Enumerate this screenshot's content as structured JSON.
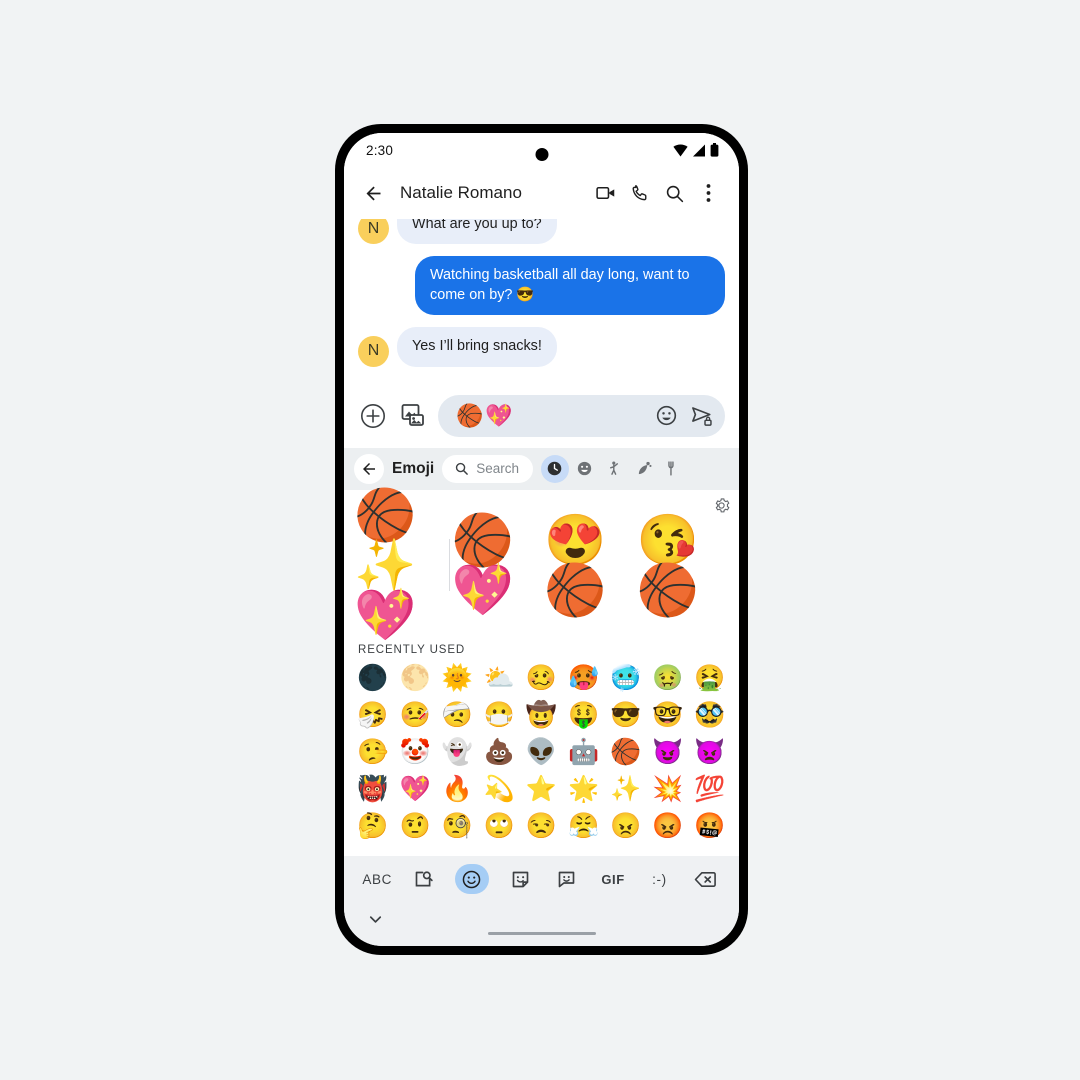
{
  "status_bar": {
    "time": "2:30",
    "icons": [
      "wifi-icon",
      "signal-icon",
      "battery-icon"
    ]
  },
  "app_bar": {
    "back_icon": "back-arrow-icon",
    "contact_name": "Natalie Romano",
    "actions": [
      "video-call-icon",
      "phone-call-icon",
      "search-icon",
      "overflow-menu-icon"
    ]
  },
  "conversation": {
    "messages": [
      {
        "sender": "Natalie Romano",
        "avatar_initial": "N",
        "direction": "incoming",
        "text": "What are you up to?",
        "clipped": true
      },
      {
        "sender": "me",
        "avatar_initial": "",
        "direction": "outgoing",
        "text": "Watching basketball all day long, want to come on by? 😎",
        "clipped": false
      },
      {
        "sender": "Natalie Romano",
        "avatar_initial": "N",
        "direction": "incoming",
        "text": "Yes I’ll bring snacks!",
        "clipped": false
      }
    ]
  },
  "compose_bar": {
    "add_icon": "plus-circle-icon",
    "gallery_icon": "gallery-icon",
    "draft_text": "🏀💖",
    "emoji_toggle_icon": "emoji-face-icon",
    "send_icon": "send-encrypted-icon"
  },
  "emoji_picker": {
    "back_icon": "back-arrow-icon",
    "title": "Emoji",
    "search_icon": "search-icon",
    "search_placeholder": "Search",
    "tabs": [
      {
        "name": "recent",
        "icon": "clock-icon",
        "active": true
      },
      {
        "name": "smileys",
        "icon": "smiley-icon",
        "active": false
      },
      {
        "name": "people",
        "icon": "person-waving-icon",
        "active": false
      },
      {
        "name": "nature",
        "icon": "plant-animal-icon",
        "active": false
      },
      {
        "name": "food",
        "icon": "food-icon",
        "active": false
      }
    ],
    "suggestions": {
      "gear_icon": "settings-gear-icon",
      "stickers": [
        "🏀✨💖",
        "🏀💖",
        "😍🏀",
        "😘🏀"
      ],
      "sticker_names": [
        "basketball-sparkle-heart-sticker",
        "basketball-heart-sticker",
        "heart-eyes-basketball-sticker",
        "kissing-basketball-sticker"
      ]
    },
    "section_label": "RECENTLY USED",
    "grid": [
      [
        "🌑",
        "🌕",
        "🌞",
        "⛅",
        "🥴",
        "🥵",
        "🥶",
        "🤢",
        "🤮"
      ],
      [
        "🤧",
        "🤒",
        "🤕",
        "😷",
        "🤠",
        "🤑",
        "😎",
        "🤓",
        "🥸"
      ],
      [
        "🤥",
        "🤡",
        "👻",
        "💩",
        "👽",
        "🤖",
        "🏀",
        "😈",
        "👿"
      ],
      [
        "👹",
        "💖",
        "🔥",
        "💫",
        "⭐",
        "🌟",
        "✨",
        "💥",
        "💯"
      ],
      [
        "🤔",
        "🤨",
        "🧐",
        "🙄",
        "😒",
        "😤",
        "😠",
        "😡",
        "🤬"
      ]
    ]
  },
  "keyboard_toolbar": {
    "items": [
      {
        "label": "ABC",
        "name": "abc-key",
        "type": "text",
        "active": false
      },
      {
        "label": "",
        "name": "image-search-icon",
        "type": "icon",
        "active": false
      },
      {
        "label": "",
        "name": "emoji-icon",
        "type": "icon",
        "active": true
      },
      {
        "label": "",
        "name": "sticker-icon",
        "type": "icon",
        "active": false
      },
      {
        "label": "",
        "name": "avatar-sticker-icon",
        "type": "icon",
        "active": false
      },
      {
        "label": "GIF",
        "name": "gif-key",
        "type": "text",
        "active": false
      },
      {
        "label": ":-)",
        "name": "emoticon-key",
        "type": "text",
        "active": false
      },
      {
        "label": "",
        "name": "backspace-icon",
        "type": "icon",
        "active": false
      }
    ],
    "collapse_icon": "chevron-down-icon"
  },
  "colors": {
    "outgoing_bubble": "#1a73e8",
    "incoming_bubble": "#e8eef9",
    "avatar": "#f9cf5c",
    "picker_header": "#eceff1",
    "tab_active": "#c7dbf7",
    "keyboard_bg": "#eff1f3",
    "page_bg": "#f1f3f4"
  }
}
